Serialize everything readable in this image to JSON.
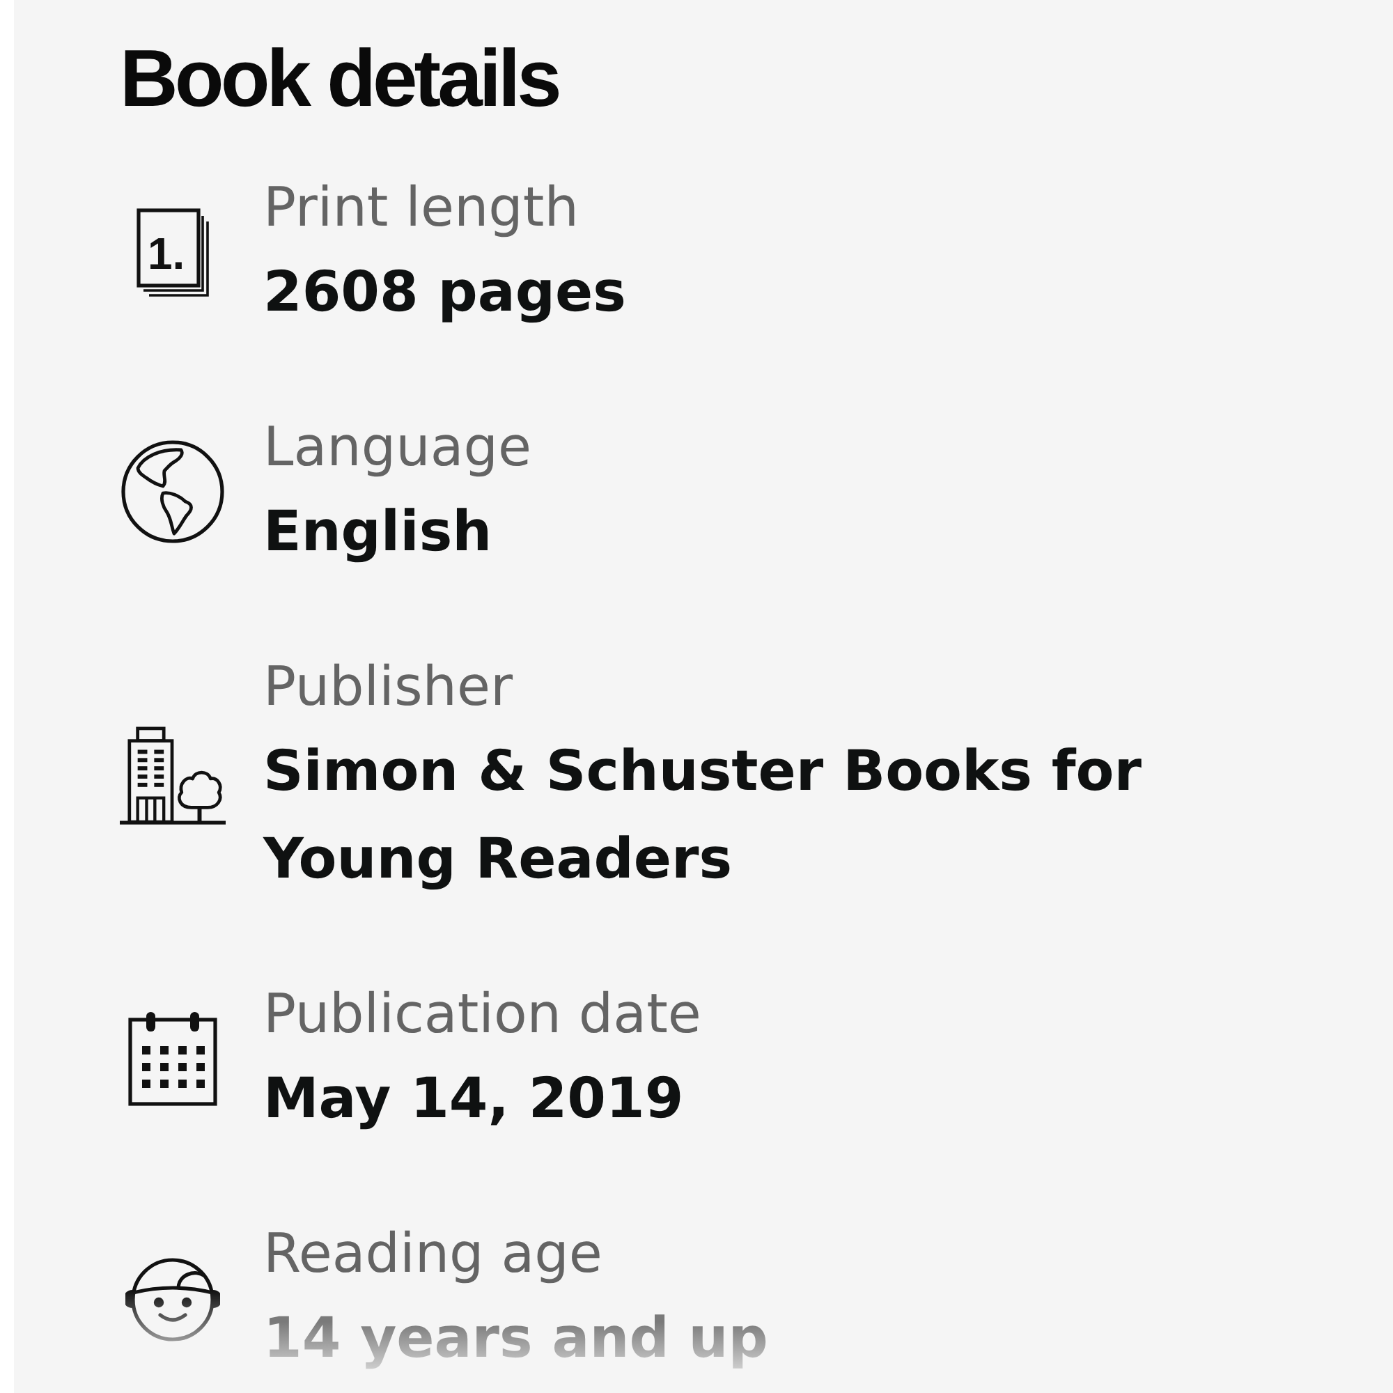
{
  "title": "Book details",
  "details": [
    {
      "kind": "pages",
      "icon_text": "1.",
      "label": "Print length",
      "value": "2608 pages",
      "faded": false
    },
    {
      "kind": "globe",
      "label": "Language",
      "value": "English",
      "faded": false
    },
    {
      "kind": "building",
      "label": "Publisher",
      "value": "Simon & Schuster Books for Young Readers",
      "faded": false
    },
    {
      "kind": "calendar",
      "label": "Publication date",
      "value": "May 14, 2019",
      "faded": false
    },
    {
      "kind": "child",
      "label": "Reading age",
      "value": "14 years and up",
      "faded": true
    }
  ]
}
